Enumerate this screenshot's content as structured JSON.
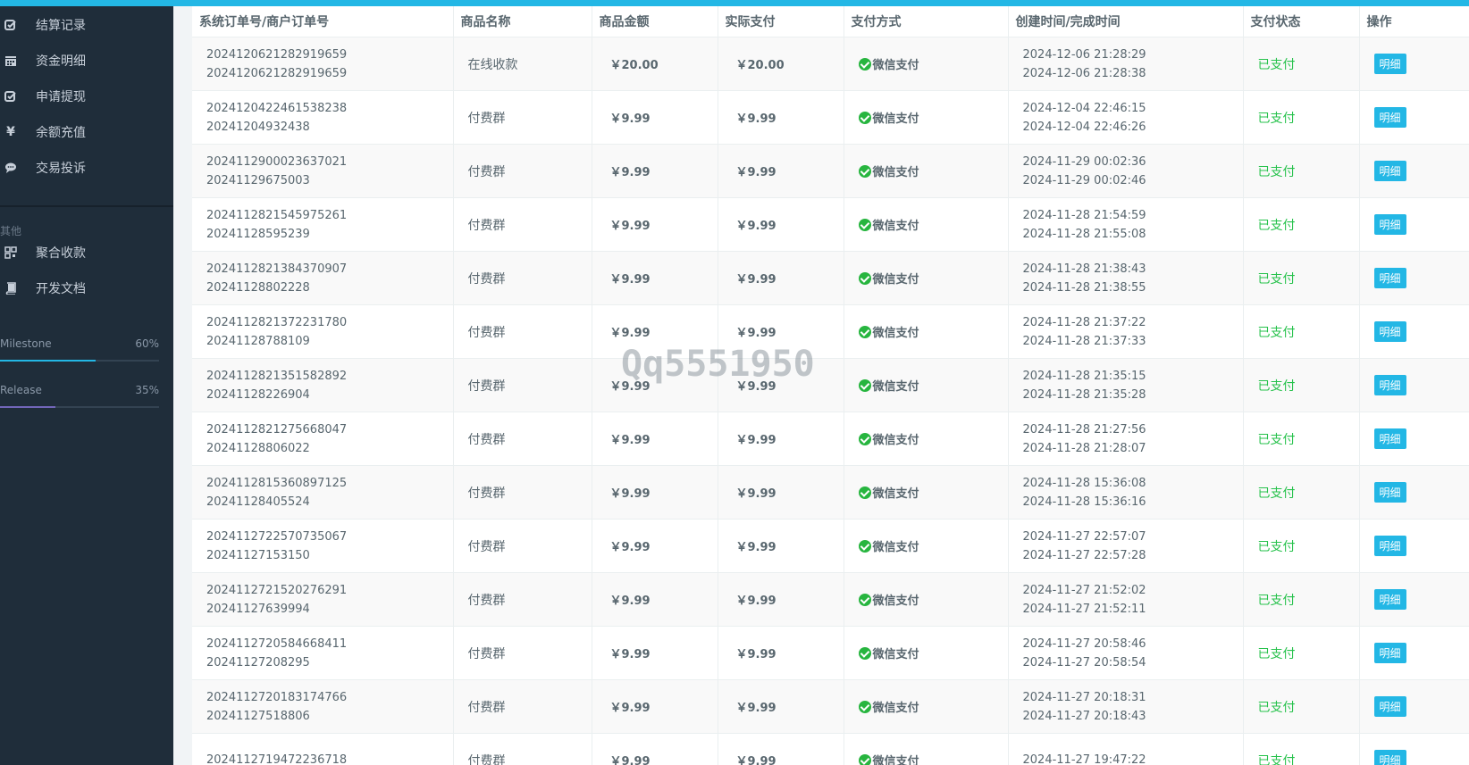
{
  "sidebar": {
    "items_top": [
      {
        "label": "结算记录",
        "icon": "checkbox-edit-icon"
      },
      {
        "label": "资金明细",
        "icon": "calendar-icon"
      },
      {
        "label": "申请提现",
        "icon": "checkbox-edit-icon"
      },
      {
        "label": "余额充值",
        "icon": "yen-icon"
      },
      {
        "label": "交易投诉",
        "icon": "chat-bubble-icon"
      }
    ],
    "section_label": "其他",
    "items_other": [
      {
        "label": "聚合收款",
        "icon": "qrcode-icon"
      },
      {
        "label": "开发文档",
        "icon": "book-icon"
      }
    ],
    "progress": [
      {
        "name": "Milestone",
        "percent_text": "60%",
        "value": 0.6,
        "color": "#23b7e5"
      },
      {
        "name": "Release",
        "percent_text": "35%",
        "value": 0.35,
        "color": "#7266ba"
      }
    ]
  },
  "table": {
    "headers": [
      "系统订单号/商户订单号",
      "商品名称",
      "商品金额",
      "实际支付",
      "支付方式",
      "创建时间/完成时间",
      "支付状态",
      "操作"
    ],
    "rows": [
      {
        "sys_order": "2024120621282919659",
        "mch_order": "2024120621282919659",
        "name": "在线收款",
        "amount": "￥20.00",
        "paid": "￥20.00",
        "method": "微信支付",
        "created": "2024-12-06 21:28:29",
        "finished": "2024-12-06 21:28:38",
        "status": "已支付",
        "action": "明细"
      },
      {
        "sys_order": "2024120422461538238",
        "mch_order": "20241204932438",
        "name": "付费群",
        "amount": "￥9.99",
        "paid": "￥9.99",
        "method": "微信支付",
        "created": "2024-12-04 22:46:15",
        "finished": "2024-12-04 22:46:26",
        "status": "已支付",
        "action": "明细"
      },
      {
        "sys_order": "2024112900023637021",
        "mch_order": "20241129675003",
        "name": "付费群",
        "amount": "￥9.99",
        "paid": "￥9.99",
        "method": "微信支付",
        "created": "2024-11-29 00:02:36",
        "finished": "2024-11-29 00:02:46",
        "status": "已支付",
        "action": "明细"
      },
      {
        "sys_order": "2024112821545975261",
        "mch_order": "20241128595239",
        "name": "付费群",
        "amount": "￥9.99",
        "paid": "￥9.99",
        "method": "微信支付",
        "created": "2024-11-28 21:54:59",
        "finished": "2024-11-28 21:55:08",
        "status": "已支付",
        "action": "明细"
      },
      {
        "sys_order": "2024112821384370907",
        "mch_order": "20241128802228",
        "name": "付费群",
        "amount": "￥9.99",
        "paid": "￥9.99",
        "method": "微信支付",
        "created": "2024-11-28 21:38:43",
        "finished": "2024-11-28 21:38:55",
        "status": "已支付",
        "action": "明细"
      },
      {
        "sys_order": "2024112821372231780",
        "mch_order": "20241128788109",
        "name": "付费群",
        "amount": "￥9.99",
        "paid": "￥9.99",
        "method": "微信支付",
        "created": "2024-11-28 21:37:22",
        "finished": "2024-11-28 21:37:33",
        "status": "已支付",
        "action": "明细"
      },
      {
        "sys_order": "2024112821351582892",
        "mch_order": "20241128226904",
        "name": "付费群",
        "amount": "￥9.99",
        "paid": "￥9.99",
        "method": "微信支付",
        "created": "2024-11-28 21:35:15",
        "finished": "2024-11-28 21:35:28",
        "status": "已支付",
        "action": "明细"
      },
      {
        "sys_order": "2024112821275668047",
        "mch_order": "20241128806022",
        "name": "付费群",
        "amount": "￥9.99",
        "paid": "￥9.99",
        "method": "微信支付",
        "created": "2024-11-28 21:27:56",
        "finished": "2024-11-28 21:28:07",
        "status": "已支付",
        "action": "明细"
      },
      {
        "sys_order": "2024112815360897125",
        "mch_order": "20241128405524",
        "name": "付费群",
        "amount": "￥9.99",
        "paid": "￥9.99",
        "method": "微信支付",
        "created": "2024-11-28 15:36:08",
        "finished": "2024-11-28 15:36:16",
        "status": "已支付",
        "action": "明细"
      },
      {
        "sys_order": "2024112722570735067",
        "mch_order": "20241127153150",
        "name": "付费群",
        "amount": "￥9.99",
        "paid": "￥9.99",
        "method": "微信支付",
        "created": "2024-11-27 22:57:07",
        "finished": "2024-11-27 22:57:28",
        "status": "已支付",
        "action": "明细"
      },
      {
        "sys_order": "2024112721520276291",
        "mch_order": "20241127639994",
        "name": "付费群",
        "amount": "￥9.99",
        "paid": "￥9.99",
        "method": "微信支付",
        "created": "2024-11-27 21:52:02",
        "finished": "2024-11-27 21:52:11",
        "status": "已支付",
        "action": "明细"
      },
      {
        "sys_order": "2024112720584668411",
        "mch_order": "20241127208295",
        "name": "付费群",
        "amount": "￥9.99",
        "paid": "￥9.99",
        "method": "微信支付",
        "created": "2024-11-27 20:58:46",
        "finished": "2024-11-27 20:58:54",
        "status": "已支付",
        "action": "明细"
      },
      {
        "sys_order": "2024112720183174766",
        "mch_order": "20241127518806",
        "name": "付费群",
        "amount": "￥9.99",
        "paid": "￥9.99",
        "method": "微信支付",
        "created": "2024-11-27 20:18:31",
        "finished": "2024-11-27 20:18:43",
        "status": "已支付",
        "action": "明细"
      },
      {
        "sys_order": "2024112719472236718",
        "mch_order": "",
        "name": "付费群",
        "amount": "￥9.99",
        "paid": "￥9.99",
        "method": "微信支付",
        "created": "2024-11-27 19:47:22",
        "finished": "",
        "status": "已支付",
        "action": "明细"
      }
    ]
  },
  "watermark": "Qq5551950",
  "colors": {
    "accent": "#23b7e5",
    "paid_status": "#27c24c",
    "wechat": "#27b53f",
    "sidebar_bg": "#1f2d3a"
  }
}
